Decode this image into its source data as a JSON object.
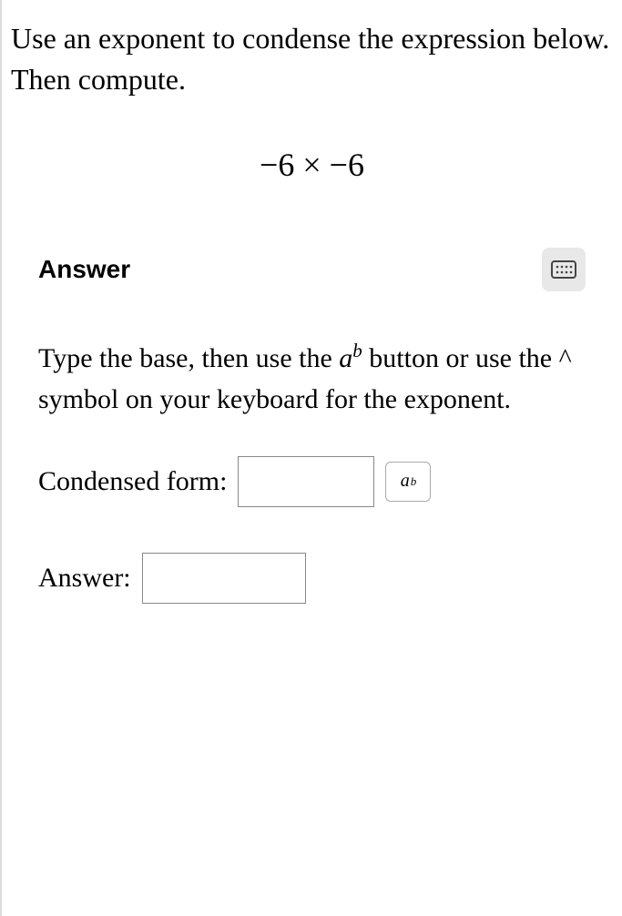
{
  "question": {
    "prompt": "Use an exponent to condense the expression below. Then compute.",
    "expression": "−6 × −6"
  },
  "answer": {
    "heading": "Answer",
    "instruction_prefix": "Type the base, then use the ",
    "instruction_math_base": "a",
    "instruction_math_exp": "b",
    "instruction_suffix": " button or use the ^ symbol on your keyboard for the exponent.",
    "condensed_label": "Condensed form:",
    "condensed_value": "",
    "exp_button_base": "a",
    "exp_button_exp": "b",
    "answer_label": "Answer:",
    "answer_value": ""
  }
}
